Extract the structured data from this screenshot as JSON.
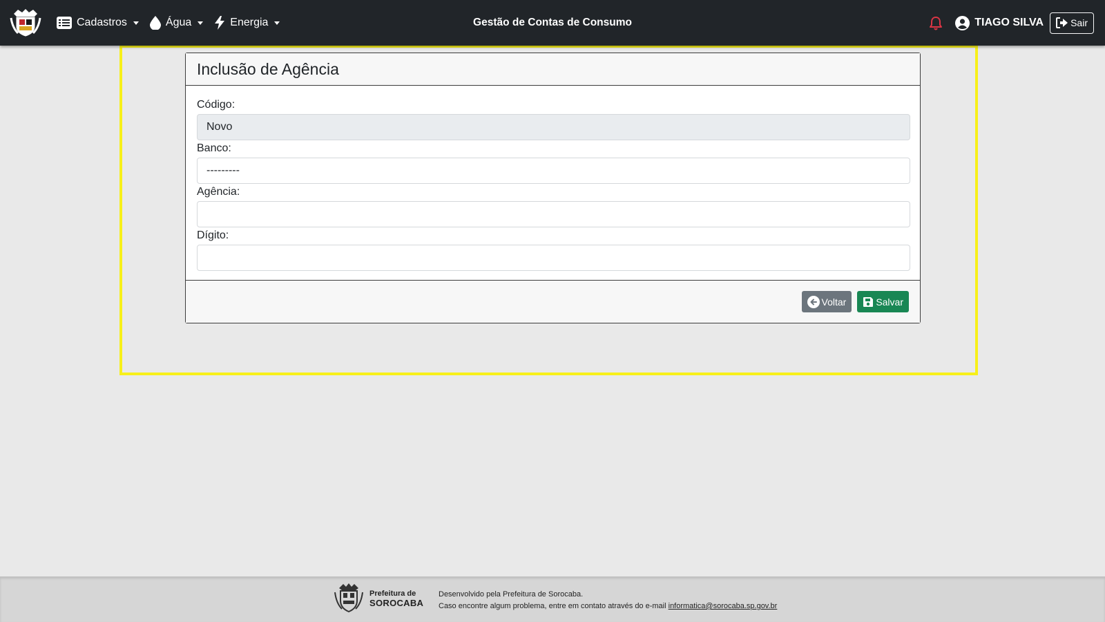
{
  "navbar": {
    "menus": [
      {
        "label": "Cadastros",
        "icon": "list-icon"
      },
      {
        "label": "Água",
        "icon": "droplet-icon"
      },
      {
        "label": "Energia",
        "icon": "lightning-icon"
      }
    ],
    "title": "Gestão de Contas de Consumo",
    "user_name": "TIAGO SILVA",
    "logout_label": "Sair",
    "accent_alert": "#dc3545"
  },
  "form": {
    "title": "Inclusão de Agência",
    "fields": {
      "codigo": {
        "label": "Código:",
        "value": "Novo"
      },
      "banco": {
        "label": "Banco:",
        "value": "---------"
      },
      "agencia": {
        "label": "Agência:",
        "value": ""
      },
      "digito": {
        "label": "Dígito:",
        "value": ""
      }
    },
    "buttons": {
      "back_label": "Voltar",
      "save_label": "Salvar"
    }
  },
  "footer": {
    "logo_line1": "Prefeitura de",
    "logo_line2": "SOROCABA",
    "line1": "Desenvolvido pela Prefeitura de Sorocaba.",
    "line2_prefix": "Caso encontre algum problema, entre em contato através do e-mail",
    "email": "informatica@sorocaba.sp.gov.br"
  },
  "colors": {
    "navbar_bg": "#212529",
    "page_bg": "#e9e9e9",
    "highlight": "#f7f01a",
    "back_button": "#6c757d",
    "save_button": "#198754"
  }
}
